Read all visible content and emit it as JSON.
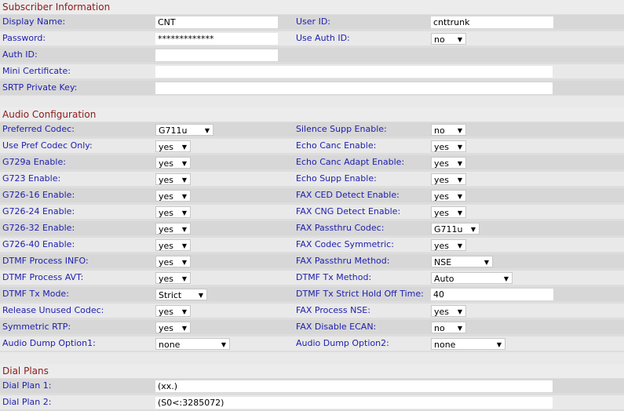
{
  "subscriber": {
    "title": "Subscriber Information",
    "display_name_label": "Display Name:",
    "display_name": "CNT",
    "user_id_label": "User ID:",
    "user_id": "cnttrunk",
    "password_label": "Password:",
    "password": "*************",
    "use_auth_id_label": "Use Auth ID:",
    "use_auth_id": "no",
    "auth_id_label": "Auth ID:",
    "auth_id": "",
    "mini_cert_label": "Mini Certificate:",
    "mini_cert": "",
    "srtp_label": "SRTP Private Key:",
    "srtp": ""
  },
  "audio": {
    "title": "Audio Configuration",
    "rows": [
      {
        "l": "Preferred Codec:",
        "lv": "G711u",
        "r": "Silence Supp Enable:",
        "rv": "no"
      },
      {
        "l": "Use Pref Codec Only:",
        "lv": "yes",
        "r": "Echo Canc Enable:",
        "rv": "yes"
      },
      {
        "l": "G729a Enable:",
        "lv": "yes",
        "r": "Echo Canc Adapt Enable:",
        "rv": "yes"
      },
      {
        "l": "G723 Enable:",
        "lv": "yes",
        "r": "Echo Supp Enable:",
        "rv": "yes"
      },
      {
        "l": "G726-16 Enable:",
        "lv": "yes",
        "r": "FAX CED Detect Enable:",
        "rv": "yes"
      },
      {
        "l": "G726-24 Enable:",
        "lv": "yes",
        "r": "FAX CNG Detect Enable:",
        "rv": "yes"
      },
      {
        "l": "G726-32 Enable:",
        "lv": "yes",
        "r": "FAX Passthru Codec:",
        "rv": "G711u"
      },
      {
        "l": "G726-40 Enable:",
        "lv": "yes",
        "r": "FAX Codec Symmetric:",
        "rv": "yes"
      },
      {
        "l": "DTMF Process INFO:",
        "lv": "yes",
        "r": "FAX Passthru Method:",
        "rv": "NSE"
      },
      {
        "l": "DTMF Process AVT:",
        "lv": "yes",
        "r": "DTMF Tx Method:",
        "rv": "Auto"
      },
      {
        "l": "DTMF Tx Mode:",
        "lv": "Strict",
        "r": "DTMF Tx Strict Hold Off Time:",
        "rv": "40"
      },
      {
        "l": "Release Unused Codec:",
        "lv": "yes",
        "r": "FAX Process NSE:",
        "rv": "yes"
      },
      {
        "l": "Symmetric RTP:",
        "lv": "yes",
        "r": "FAX Disable ECAN:",
        "rv": "no"
      },
      {
        "l": "Audio Dump Option1:",
        "lv": "none",
        "r": "Audio Dump Option2:",
        "rv": "none"
      }
    ]
  },
  "dial": {
    "title": "Dial Plans",
    "plan1_label": "Dial Plan 1:",
    "plan1": "(xx.)",
    "plan2_label": "Dial Plan 2:",
    "plan2": "(S0<:3285072)"
  },
  "select_arrow": "▼"
}
